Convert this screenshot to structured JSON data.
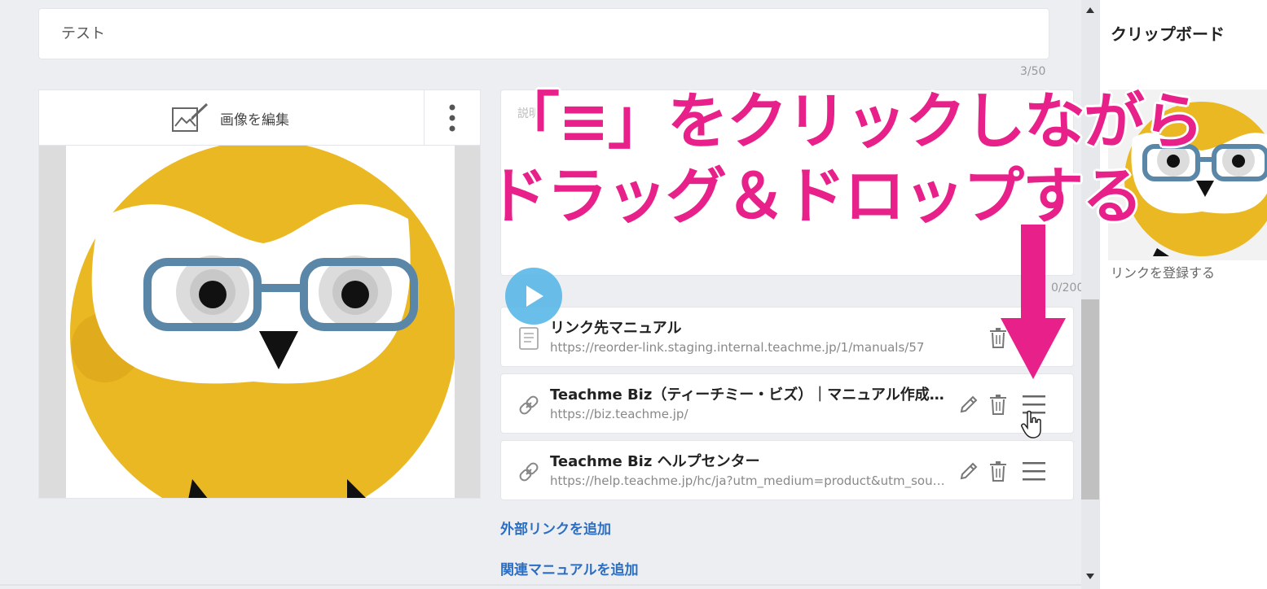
{
  "title_input": {
    "value": "テスト"
  },
  "title_counter": "3/50",
  "image_editor": {
    "edit_label": "画像を編集"
  },
  "description": {
    "placeholder": "説明",
    "counter": "0/200"
  },
  "links": [
    {
      "title": "リンク先マニュアル",
      "url": "https://reorder-link.staging.internal.teachme.jp/1/manuals/57",
      "icon": "manual-document-icon"
    },
    {
      "title": "Teachme Biz（ティーチミー・ビズ）｜マニュアル作成・共有システム",
      "url": "https://biz.teachme.jp/",
      "icon": "link-chain-icon"
    },
    {
      "title": "Teachme Biz ヘルプセンター",
      "url": "https://help.teachme.jp/hc/ja?utm_medium=product&utm_source=teachme",
      "icon": "link-chain-icon"
    }
  ],
  "actions": {
    "add_external_link": "外部リンクを追加",
    "add_related_manual": "関連マニュアルを追加"
  },
  "clipboard": {
    "title": "クリップボード",
    "register_link": "リンクを登録する"
  },
  "overlay": {
    "line1": "「≡」をクリックしながら",
    "line2": "ドラッグ＆ドロップする"
  },
  "colors": {
    "accent_pink": "#e8218a",
    "link_blue": "#2c6ec2",
    "owl_yellow": "#e9b823",
    "glasses_blue": "#5a86a8"
  }
}
